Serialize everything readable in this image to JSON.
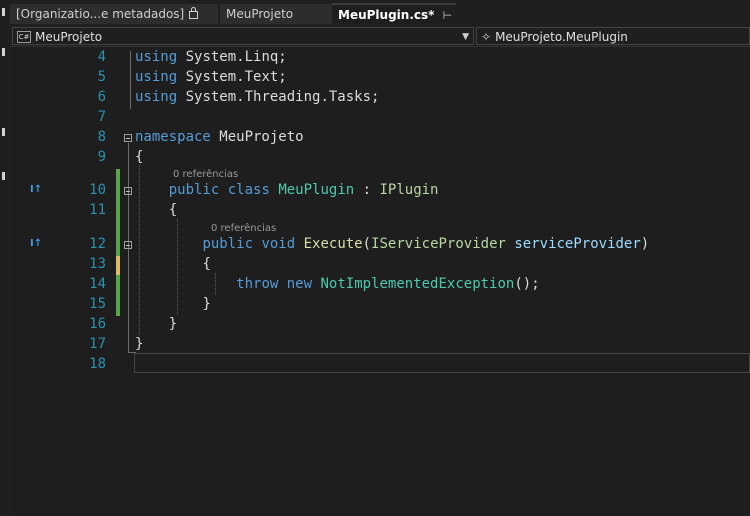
{
  "tabs": [
    {
      "label": "[Organizatio...e metadados]",
      "locked": true
    },
    {
      "label": "MeuProjeto"
    },
    {
      "label": "MeuPlugin.cs*",
      "active": true,
      "pin_icon": "pin-icon",
      "close_icon": "close-icon"
    }
  ],
  "nav": {
    "project": "MeuProjeto",
    "project_icon": "C#",
    "member": "MeuProjeto.MeuPlugin"
  },
  "editor": {
    "line_numbers": [
      "4",
      "5",
      "6",
      "7",
      "8",
      "9",
      "10",
      "11",
      "12",
      "13",
      "14",
      "15",
      "16",
      "17",
      "18"
    ],
    "lens_1": "0 referências",
    "lens_2": "0 referências",
    "code": {
      "l4": {
        "kw": "using",
        "rest": " System.Linq;"
      },
      "l5": {
        "kw": "using",
        "rest": " System.Text;"
      },
      "l6": {
        "kw": "using",
        "rest": " System.Threading.Tasks;"
      },
      "l8": {
        "kw": "namespace",
        "rest": " MeuProjeto"
      },
      "l9": "{",
      "l10": {
        "kw1": "public",
        "kw2": "class",
        "type": "MeuPlugin",
        "sep": " : ",
        "iface": "IPlugin"
      },
      "l11": "{",
      "l12": {
        "kw1": "public",
        "kw2": "void",
        "method": "Execute",
        "open": "(",
        "type": "IServiceProvider",
        "param": "serviceProvider",
        "close": ")"
      },
      "l13": "{",
      "l14": {
        "kw1": "throw",
        "kw2": "new",
        "type": "NotImplementedException",
        "tail": "();"
      },
      "l15": "}",
      "l16": "}",
      "l17": "}"
    }
  },
  "colors": {
    "background": "#1e1e1e",
    "keyword": "#569cd6",
    "type": "#4ec9b0",
    "interface": "#b8d7a3",
    "method": "#dcdcaa",
    "parameter": "#9cdcfe",
    "line_number": "#2b91af",
    "change_saved": "#57a64a",
    "change_unsaved": "#dcbc60"
  }
}
